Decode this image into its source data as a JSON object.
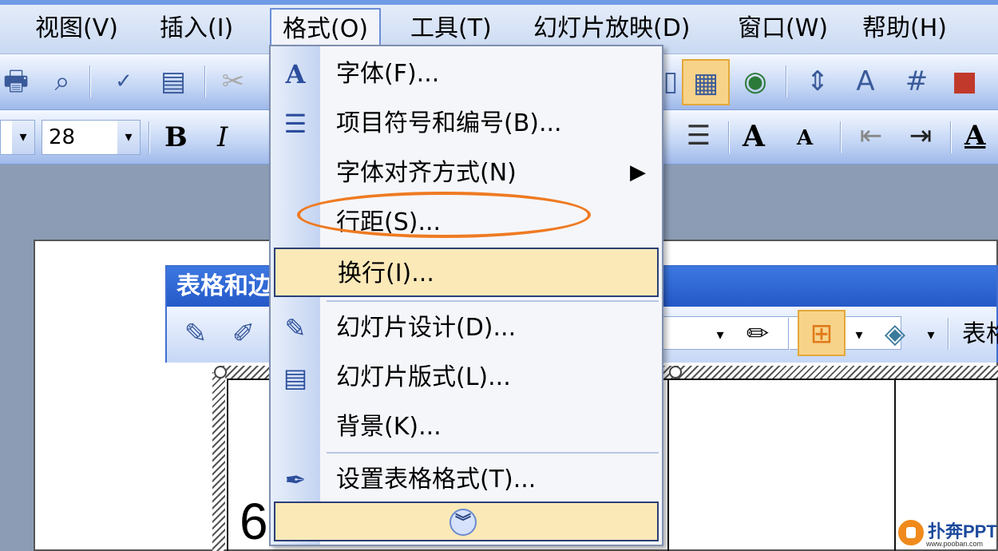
{
  "menubar": {
    "items": [
      "视图(V)",
      "插入(I)",
      "格式(O)",
      "工具(T)",
      "幻灯片放映(D)",
      "窗口(W)",
      "帮助(H)"
    ],
    "active_index": 2
  },
  "toolbar": {
    "font_size": "28",
    "bold_label": "B",
    "italic_label": "I",
    "grow_label": "A",
    "shrink_label": "A",
    "icons": [
      "print-icon",
      "print-preview-icon",
      "spelling-icon",
      "research-icon",
      "cut-icon",
      "table-draw-icon",
      "hyperlink-icon",
      "text-direction-icon",
      "grid-icon",
      "color-icon"
    ]
  },
  "floating_toolbar": {
    "title": "表格和边",
    "trailing_text": "表格"
  },
  "format_menu": {
    "items": [
      {
        "label": "字体(F)...",
        "icon": "font-icon"
      },
      {
        "label": "项目符号和编号(B)...",
        "icon": "bullets-icon"
      },
      {
        "label": "字体对齐方式(N)",
        "icon": "",
        "submenu": true
      },
      {
        "label": "行距(S)...",
        "icon": ""
      },
      {
        "label": "换行(I)...",
        "icon": ""
      },
      {
        "label": "幻灯片设计(D)...",
        "icon": "slide-design-icon"
      },
      {
        "label": "幻灯片版式(L)...",
        "icon": "slide-layout-icon"
      },
      {
        "label": "背景(K)...",
        "icon": ""
      },
      {
        "label": "设置表格格式(T)...",
        "icon": "table-format-icon"
      }
    ],
    "highlighted_index": 4,
    "circled_index": 3,
    "submenu_arrow": "▶",
    "expand_label": "»"
  },
  "table": {
    "cell_text": "6"
  },
  "watermark": {
    "name": "扑奔PPT",
    "url": "www.pooban.com"
  },
  "colors": {
    "circle_annotation": "#ef7a21",
    "highlight": "#fbe9b8",
    "title_bar": "#2458c8"
  }
}
